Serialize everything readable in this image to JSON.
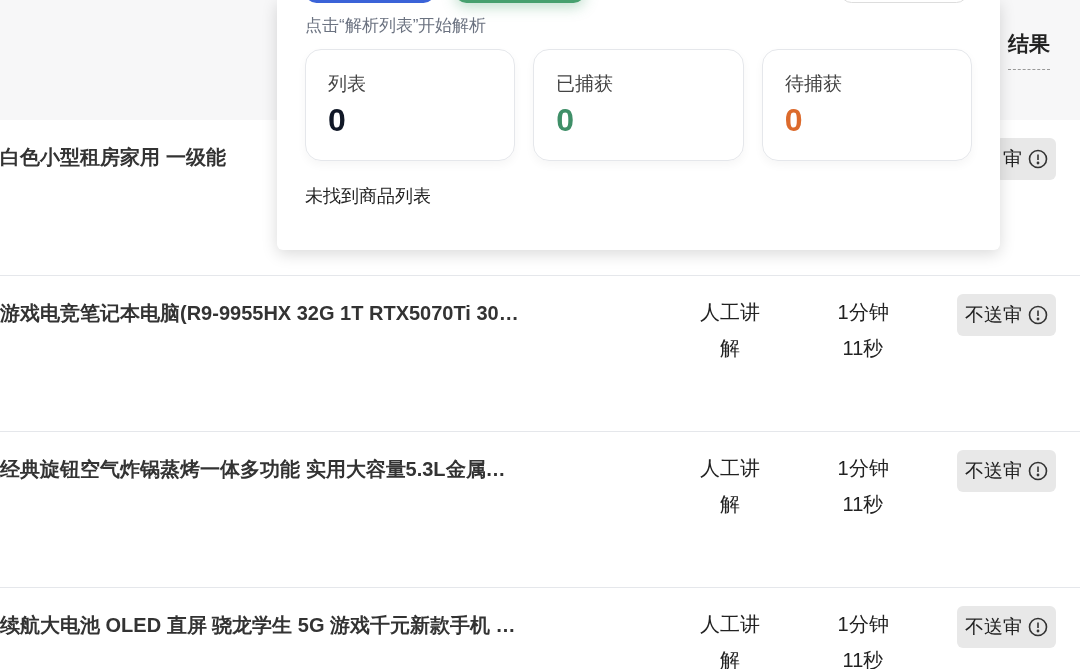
{
  "table": {
    "columns": [
      {
        "label": "结果"
      }
    ],
    "rows": [
      {
        "title": "白色小型租房家用 一级能",
        "mode": "",
        "duration": "",
        "badge": "审"
      },
      {
        "title": "游戏电竞笔记本电脑(R9-9955HX 32G 1T RTX5070Ti 30…",
        "mode": "人工讲解",
        "duration": "1分钟11秒",
        "badge": "不送审"
      },
      {
        "title": "经典旋钮空气炸锅蒸烤一体多功能 实用大容量5.3L金属…",
        "mode": "人工讲解",
        "duration": "1分钟11秒",
        "badge": "不送审"
      },
      {
        "title": "续航大电池 OLED 直屏 骁龙学生 5G 游戏千元新款手机 …",
        "mode": "人工讲解",
        "duration": "1分钟11秒",
        "badge": "不送审"
      }
    ]
  },
  "popup": {
    "hint": "点击“解析列表”开始解析",
    "stats": [
      {
        "label": "列表",
        "value": "0",
        "color": "#111827"
      },
      {
        "label": "已捕获",
        "value": "0",
        "color": "#3f8f68"
      },
      {
        "label": "待捕获",
        "value": "0",
        "color": "#dc6a2c"
      }
    ],
    "message": "未找到商品列表"
  }
}
